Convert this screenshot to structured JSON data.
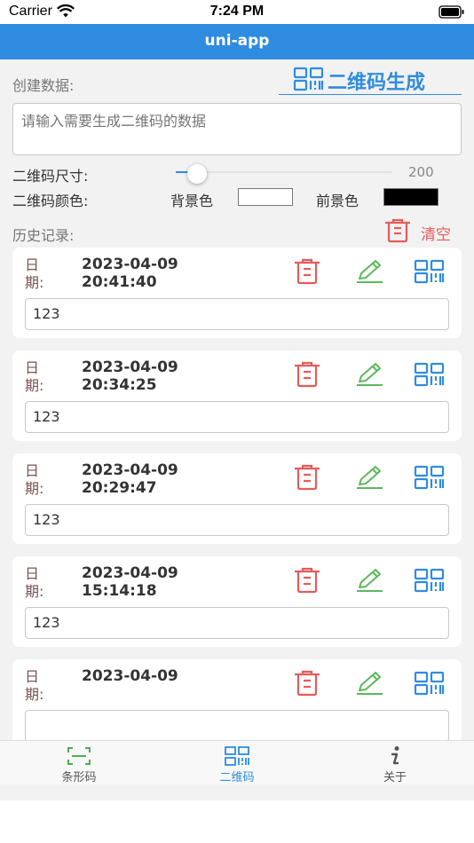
{
  "status_bar": {
    "carrier": "Carrier",
    "time": "7:24 PM"
  },
  "nav": {
    "title": "uni-app"
  },
  "create": {
    "label": "创建数据:",
    "generate_label": "二维码生成",
    "input_placeholder": "请输入需要生成二维码的数据"
  },
  "settings": {
    "size_label": "二维码尺寸:",
    "size_value": "200",
    "size_fraction": 0.1,
    "color_label": "二维码颜色:",
    "bg_label": "背景色",
    "bg_color": "#ffffff",
    "fg_label": "前景色",
    "fg_color": "#000000"
  },
  "history": {
    "label": "历史记录:",
    "clear_label": "清空",
    "date_label": "日期:",
    "records": [
      {
        "date": "2023-04-09",
        "time": "20:41:40",
        "value": "123"
      },
      {
        "date": "2023-04-09",
        "time": "20:34:25",
        "value": "123"
      },
      {
        "date": "2023-04-09",
        "time": "20:29:47",
        "value": "123"
      },
      {
        "date": "2023-04-09",
        "time": "15:14:18",
        "value": "123"
      },
      {
        "date": "2023-04-09",
        "time": "",
        "value": ""
      }
    ]
  },
  "tabs": [
    {
      "label": "条形码",
      "icon": "scan-icon",
      "active": false
    },
    {
      "label": "二维码",
      "icon": "qrcode-icon",
      "active": true
    },
    {
      "label": "关于",
      "icon": "info-icon",
      "active": false
    }
  ],
  "colors": {
    "accent": "#2f8ce0",
    "danger": "#e55b5b",
    "edit": "#5cb85c",
    "date_label": "#7a5151",
    "scan_icon": "#4caf50"
  }
}
